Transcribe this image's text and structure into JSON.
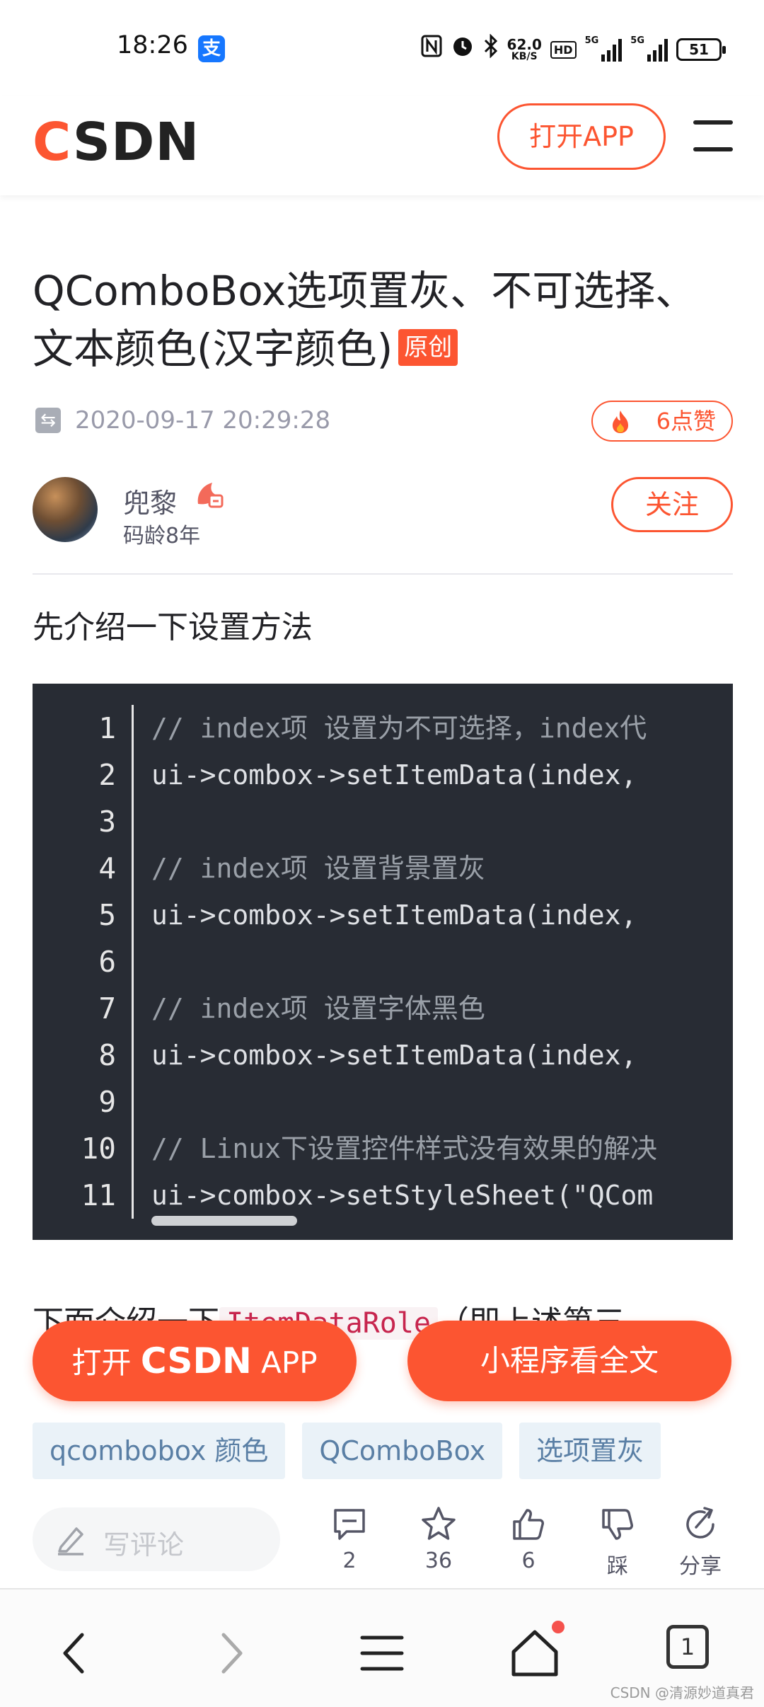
{
  "status_bar": {
    "time": "18:26",
    "speed_value": "62.0",
    "speed_unit": "KB/S",
    "hd_label": "HD",
    "net1": "5G",
    "net2": "5G",
    "battery": "51"
  },
  "header": {
    "logo_c": "C",
    "logo_rest": "SDN",
    "open_app": "打开APP"
  },
  "article": {
    "title": "QComboBox选项置灰、不可选择、文本颜色(汉字颜色)",
    "original_badge": "原创",
    "date": "2020-09-17 20:29:28",
    "likes": "6点赞",
    "author_name": "兜黎",
    "author_years": "码龄8年",
    "follow": "关注",
    "intro": "先介绍一下设置方法",
    "code": {
      "line_numbers": [
        "1",
        "2",
        "3",
        "4",
        "5",
        "6",
        "7",
        "8",
        "9",
        "10",
        "11"
      ],
      "lines": [
        "// index项 设置为不可选择，index代",
        "ui->combox->setItemData(index,",
        "",
        "// index项 设置背景置灰",
        "ui->combox->setItemData(index,",
        "",
        "// index项 设置字体黑色",
        "ui->combox->setItemData(index,",
        "",
        "// Linux下设置控件样式没有效果的解决",
        "ui->combox->setStyleSheet(\"QCom"
      ]
    },
    "para2_prefix": "下面介绍一下",
    "para2_code": "ItemDataRole",
    "para2_suffix": "（即上述第三"
  },
  "floating": {
    "open_prefix": "打开",
    "open_brand": "CSDN",
    "open_suffix": "APP",
    "mini_program": "小程序看全文"
  },
  "tags": [
    "qcombobox 颜色",
    "QComboBox",
    "选项置灰"
  ],
  "toolbar": {
    "comment_placeholder": "写评论",
    "comments": "2",
    "favorites": "36",
    "likes": "6",
    "dislike": "踩",
    "share": "分享"
  },
  "system_nav": {
    "tab_count": "1"
  },
  "watermark": "CSDN @清源妙道真君",
  "colors": {
    "brand": "#fc5531",
    "code_bg": "#282c34",
    "tag_bg": "#eaf2f8",
    "tag_text": "#5a7fa5"
  },
  "icons": [
    "alipay-icon",
    "nfc-icon",
    "alarm-icon",
    "bluetooth-icon",
    "menu-icon",
    "fire-icon",
    "pen-icon",
    "comment-icon",
    "star-icon",
    "thumb-up-icon",
    "thumb-down-icon",
    "share-icon",
    "back-icon",
    "forward-icon",
    "tabs-menu-icon",
    "home-icon"
  ]
}
